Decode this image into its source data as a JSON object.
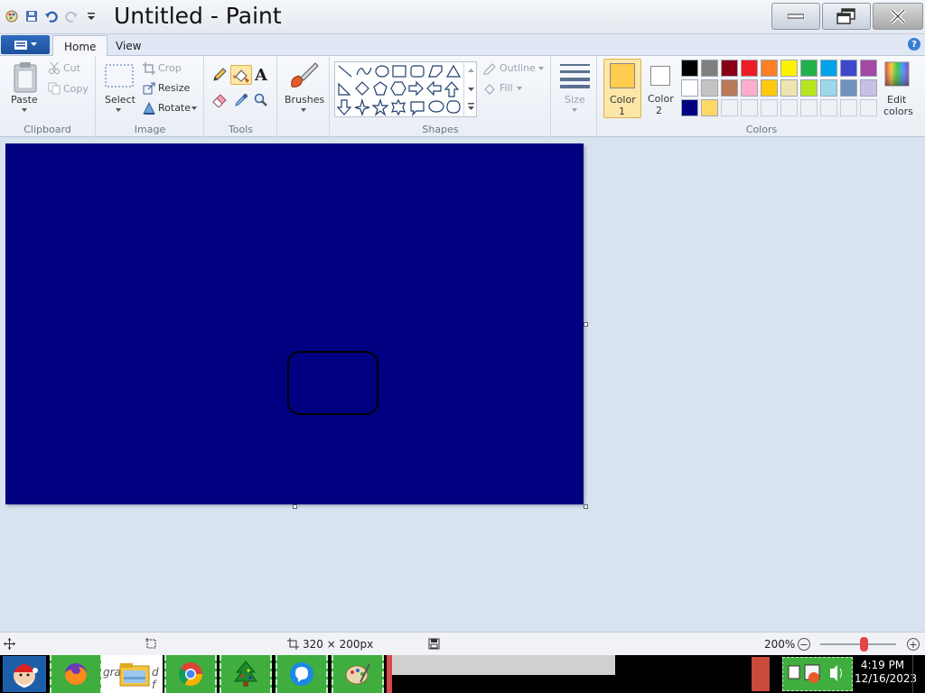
{
  "window": {
    "title": "Untitled - Paint"
  },
  "tabs": {
    "file_icon": "menu-icon",
    "home": "Home",
    "view": "View"
  },
  "ribbon": {
    "clipboard": {
      "paste": "Paste",
      "cut": "Cut",
      "copy": "Copy",
      "label": "Clipboard"
    },
    "image": {
      "select": "Select",
      "crop": "Crop",
      "resize": "Resize",
      "rotate": "Rotate",
      "label": "Image"
    },
    "tools": {
      "label": "Tools",
      "text_glyph": "A"
    },
    "brushes": {
      "label": "Brushes"
    },
    "shapes": {
      "outline": "Outline",
      "fill": "Fill",
      "label": "Shapes"
    },
    "size": {
      "label": "Size"
    },
    "colors": {
      "color1": [
        "Color",
        "1"
      ],
      "color2": [
        "Color",
        "2"
      ],
      "edit": [
        "Edit",
        "colors"
      ],
      "label": "Colors",
      "color1_value": "#ffcc4d",
      "color2_value": "#ffffff",
      "palette_row1": [
        "#000000",
        "#7f7f7f",
        "#880015",
        "#ed1c24",
        "#ff7f27",
        "#fff200",
        "#22b14c",
        "#00a2e8",
        "#3f48cc",
        "#a349a4"
      ],
      "palette_row2": [
        "#ffffff",
        "#c3c3c3",
        "#b97a57",
        "#ffaec9",
        "#ffc90e",
        "#efe4b0",
        "#b5e61d",
        "#99d9ea",
        "#7092be",
        "#c8bfe7"
      ],
      "palette_row3": [
        "#000080",
        "#ffd966"
      ]
    }
  },
  "canvas": {
    "background": "#000080"
  },
  "status": {
    "dimensions": "320 × 200px",
    "zoom": "200%"
  },
  "taskbar": {
    "partial_text": "gra",
    "partial_text2": "d f",
    "time": "4:19 PM",
    "date": "12/16/2023"
  }
}
